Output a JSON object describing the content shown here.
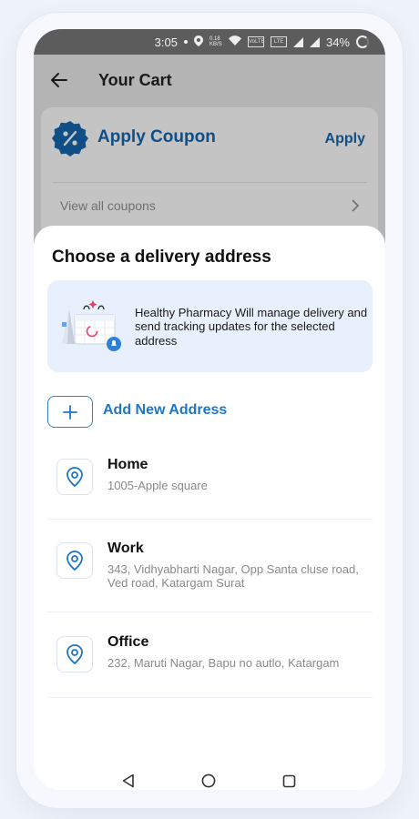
{
  "status_bar": {
    "time": "3:05",
    "speed": "0.18 KB/S",
    "battery": "34%"
  },
  "header": {
    "title": "Your Cart",
    "back_icon": "back-arrow-icon"
  },
  "coupon": {
    "title": "Apply Coupon",
    "apply_label": "Apply",
    "view_all_label": "View all coupons",
    "icon": "percent-badge-icon"
  },
  "sheet": {
    "title": "Choose a delivery address",
    "info_text": "Healthy Pharmacy Will manage delivery and send tracking updates for the selected address",
    "add_label": "Add New Address",
    "addresses": [
      {
        "name": "Home",
        "line": "1005-Apple square"
      },
      {
        "name": "Work",
        "line": "343, Vidhyabharti Nagar, Opp Santa cluse road, Ved road, Katargam Surat"
      },
      {
        "name": "Office",
        "line": "232, Maruti Nagar, Bapu no autlo, Katargam"
      }
    ]
  },
  "colors": {
    "accent": "#1d77c6",
    "info_bg": "#e7f0fc",
    "coupon_text": "#0f4f86"
  }
}
